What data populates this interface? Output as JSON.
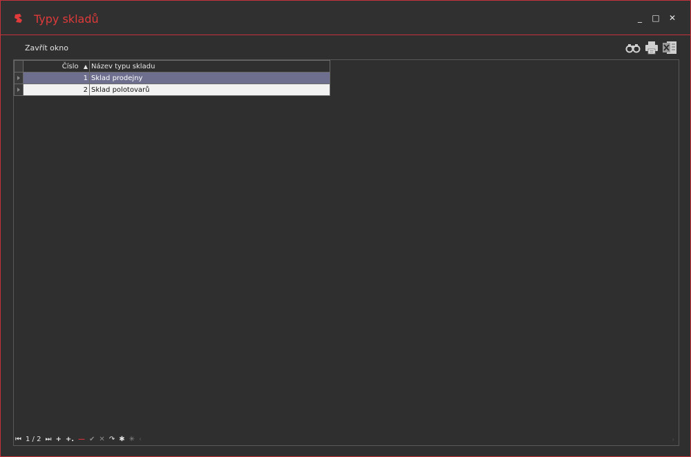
{
  "window": {
    "title": "Typy skladů",
    "controls": {
      "minimize": "_",
      "maximize": "□",
      "close": "✕"
    }
  },
  "toolbar": {
    "close_label": "Zavřít okno",
    "icons": [
      "binoculars-icon",
      "printer-icon",
      "excel-icon"
    ]
  },
  "grid": {
    "columns": [
      {
        "label": "Číslo",
        "sort": "ascending"
      },
      {
        "label": "Název typu skladu"
      }
    ],
    "rows": [
      {
        "cislo": "1",
        "nazev": "Sklad prodejny",
        "selected": true
      },
      {
        "cislo": "2",
        "nazev": "Sklad polotovarů",
        "selected": false
      }
    ]
  },
  "navigator": {
    "position": "1 / 2",
    "buttons": [
      "first",
      "last",
      "append",
      "insert",
      "delete",
      "post",
      "cancel",
      "refresh",
      "filter",
      "clear-filter"
    ]
  },
  "colors": {
    "accent": "#c8323a",
    "background": "#2f2f2f",
    "selected_row": "#6e6f8e"
  }
}
